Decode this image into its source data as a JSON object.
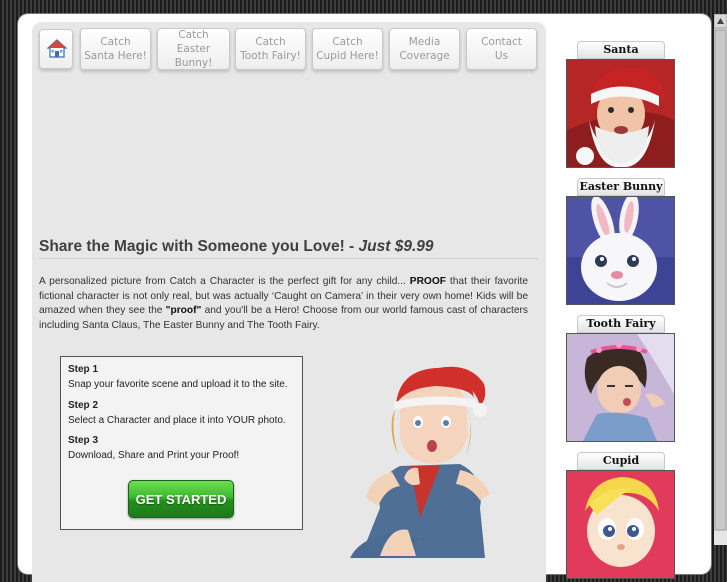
{
  "nav": {
    "home_icon": "house-icon",
    "tabs": [
      {
        "line1": "Catch",
        "line2": "Santa Here!"
      },
      {
        "line1": "Catch",
        "line2": "Easter Bunny!"
      },
      {
        "line1": "Catch",
        "line2": "Tooth Fairy!"
      },
      {
        "line1": "Catch",
        "line2": "Cupid Here!"
      },
      {
        "line1": "Media",
        "line2": "Coverage"
      },
      {
        "line1": "Contact",
        "line2": "Us"
      }
    ]
  },
  "headline": {
    "main": "Share the Magic with Someone you Love! - ",
    "price": "Just $9.99"
  },
  "intro": {
    "part1": "A personalized picture from Catch a Character is the perfect gift for any child... ",
    "proof1": "PROOF",
    "part2": " that their favorite fictional character is not only real, but was actually ‘Caught on Camera’ in their very own home! Kids will be amazed when they see the ",
    "proof2": "\"proof\"",
    "part3": "  and you'll be a Hero! Choose from our world famous cast of characters including Santa Claus, The Easter Bunny and The Tooth Fairy."
  },
  "steps": [
    {
      "title": "Step 1",
      "text": "Snap your favorite scene and upload it to the site."
    },
    {
      "title": "Step 2",
      "text": "Select a Character and place it into YOUR photo."
    },
    {
      "title": "Step 3",
      "text": "Download, Share and Print your Proof!"
    }
  ],
  "cta": {
    "label": "GET STARTED",
    "color": "#2fa82a"
  },
  "sidebar": {
    "items": [
      {
        "label": "Santa"
      },
      {
        "label": "Easter Bunny"
      },
      {
        "label": "Tooth Fairy"
      },
      {
        "label": "Cupid"
      }
    ]
  },
  "colors": {
    "page_bg": "#ffffff",
    "main_panel": "#e7e7e7",
    "text": "#333333"
  }
}
